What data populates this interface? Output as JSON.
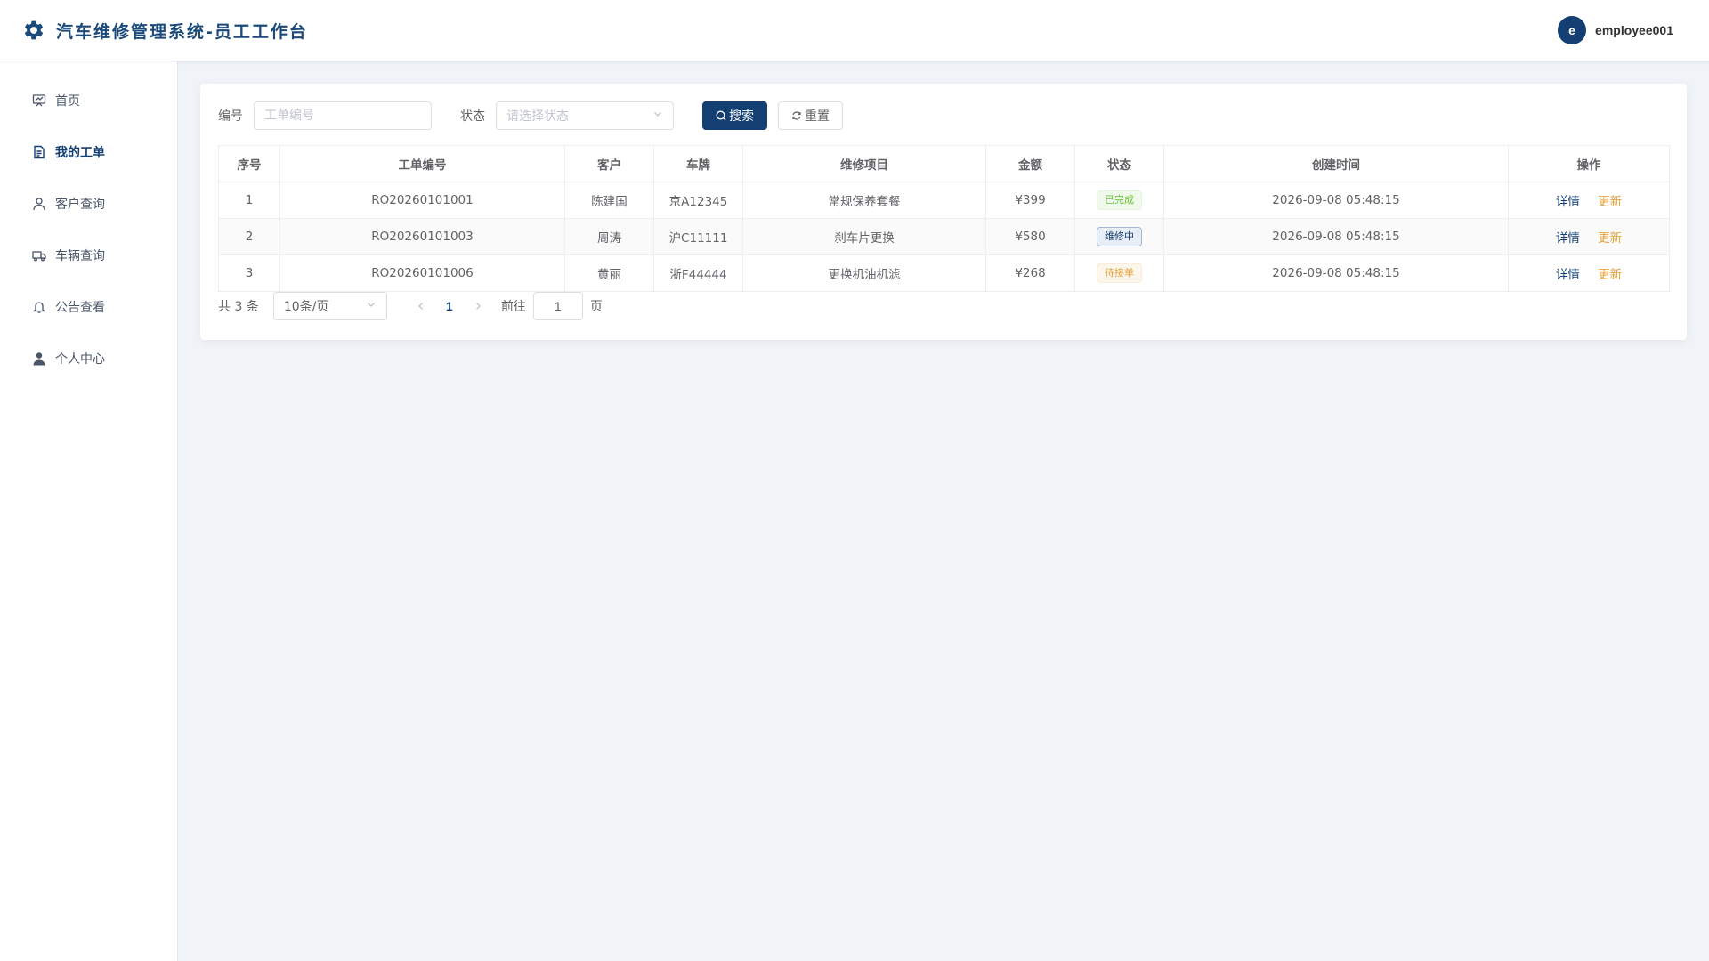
{
  "header": {
    "title": "汽车维修管理系统-员工工作台",
    "logo_icon": "gear-icon",
    "user": {
      "avatar_letter": "e",
      "name": "employee001"
    },
    "colors": {
      "brand": "#143f73"
    }
  },
  "sidebar": {
    "items": [
      {
        "label": "首页",
        "icon": "presentation-icon",
        "active": false
      },
      {
        "label": "我的工单",
        "icon": "document-icon",
        "active": true
      },
      {
        "label": "客户查询",
        "icon": "user-icon",
        "active": false
      },
      {
        "label": "车辆查询",
        "icon": "truck-icon",
        "active": false
      },
      {
        "label": "公告查看",
        "icon": "bell-icon",
        "active": false
      },
      {
        "label": "个人中心",
        "icon": "user-filled-icon",
        "active": false
      }
    ]
  },
  "filters": {
    "code_label": "编号",
    "code_placeholder": "工单编号",
    "status_label": "状态",
    "status_placeholder": "请选择状态",
    "search_label": "搜索",
    "reset_label": "重置"
  },
  "table": {
    "headers": [
      "序号",
      "工单编号",
      "客户",
      "车牌",
      "维修项目",
      "金额",
      "状态",
      "创建时间",
      "操作"
    ],
    "rows": [
      {
        "index": "1",
        "code": "RO20260101001",
        "customer": "陈建国",
        "plate": "京A12345",
        "item": "常规保养套餐",
        "amount": "¥399",
        "status": "已完成",
        "status_type": "success",
        "created": "2026-09-08 05:48:15"
      },
      {
        "index": "2",
        "code": "RO20260101003",
        "customer": "周涛",
        "plate": "沪C11111",
        "item": "刹车片更换",
        "amount": "¥580",
        "status": "维修中",
        "status_type": "primary",
        "created": "2026-09-08 05:48:15"
      },
      {
        "index": "3",
        "code": "RO20260101006",
        "customer": "黄丽",
        "plate": "浙F44444",
        "item": "更换机油机滤",
        "amount": "¥268",
        "status": "待接单",
        "status_type": "warning",
        "created": "2026-09-08 05:48:15"
      }
    ],
    "op_detail": "详情",
    "op_update": "更新"
  },
  "pagination": {
    "total_text": "共 3 条",
    "page_size": "10条/页",
    "current_page": "1",
    "goto_label": "前往",
    "jump_value": "1",
    "page_suffix": "页"
  }
}
